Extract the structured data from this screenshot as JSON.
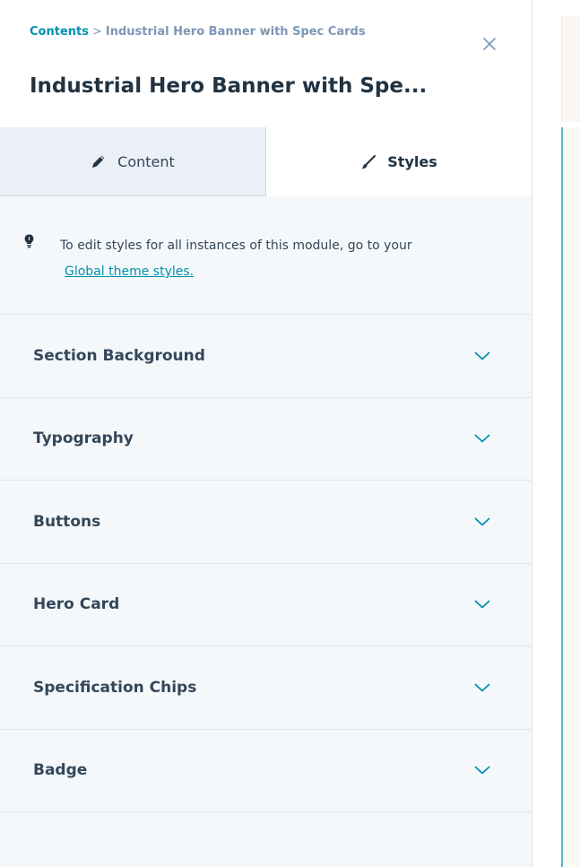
{
  "breadcrumb": {
    "root": "Contents",
    "separator": ">",
    "current": "Industrial Hero Banner with Spec Cards"
  },
  "header": {
    "title": "Industrial Hero Banner with Spe..."
  },
  "tabs": [
    {
      "label": "Content",
      "icon": "pencil-icon",
      "active": false
    },
    {
      "label": "Styles",
      "icon": "brush-icon",
      "active": true
    }
  ],
  "notice": {
    "icon": "lightbulb-icon",
    "text": "To edit styles for all instances of this module, go to your",
    "link": "Global theme styles."
  },
  "sections": [
    {
      "label": "Section Background"
    },
    {
      "label": "Typography"
    },
    {
      "label": "Buttons"
    },
    {
      "label": "Hero Card"
    },
    {
      "label": "Specification Chips"
    },
    {
      "label": "Badge"
    }
  ],
  "colors": {
    "accent": "#0091ae",
    "text": "#33475b",
    "panel_bg": "#f5f8fa",
    "tab_inactive_bg": "#eaf0f6"
  }
}
